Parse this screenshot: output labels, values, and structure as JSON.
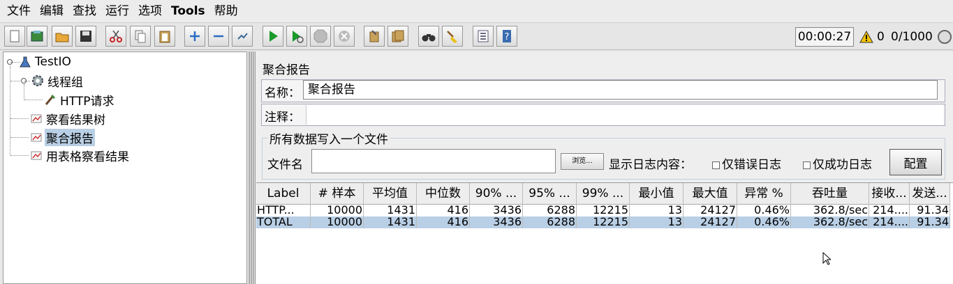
{
  "menu": [
    "文件",
    "编辑",
    "查找",
    "运行",
    "选项",
    "Tools",
    "帮助"
  ],
  "toolbar_icons": [
    "new-icon",
    "templates-icon",
    "open-icon",
    "save-icon",
    "cut-icon",
    "copy-icon",
    "paste-icon",
    "expand-icon",
    "collapse-icon",
    "toggle-icon",
    "start-icon",
    "start-no-pause-icon",
    "stop-icon",
    "shutdown-icon",
    "clear-icon",
    "clear-all-icon",
    "search-icon",
    "reset-search-icon",
    "function-helper-icon",
    "help-icon"
  ],
  "status": {
    "timer": "00:00:27",
    "warnings": "0",
    "threads": "0/1000"
  },
  "tree": {
    "root": "TestIO",
    "thread_group": "线程组",
    "http_request": "HTTP请求",
    "result_tree": "察看结果树",
    "aggregate": "聚合报告",
    "table_results": "用表格察看结果"
  },
  "panel": {
    "title": "聚合报告",
    "name_label": "名称：",
    "name_value": "聚合报告",
    "comment_label": "注释：",
    "group_title": "所有数据写入一个文件",
    "file_label": "文件名",
    "browse_label": "浏览...",
    "log_label": "显示日志内容：",
    "errors_only": "仅错误日志",
    "success_only": "仅成功日志",
    "config_label": "配置"
  },
  "table": {
    "headers": [
      "Label",
      "# 样本",
      "平均值",
      "中位数",
      "90% ...",
      "95% ...",
      "99% ...",
      "最小值",
      "最大值",
      "异常 %",
      "吞吐量",
      "接收...",
      "发送..."
    ],
    "rows": [
      [
        "HTTP...",
        "10000",
        "1431",
        "416",
        "3436",
        "6288",
        "12215",
        "13",
        "24127",
        "0.46%",
        "362.8/sec",
        "214....",
        "91.34"
      ],
      [
        "TOTAL",
        "10000",
        "1431",
        "416",
        "3436",
        "6288",
        "12215",
        "13",
        "24127",
        "0.46%",
        "362.8/sec",
        "214....",
        "91.34"
      ]
    ]
  }
}
